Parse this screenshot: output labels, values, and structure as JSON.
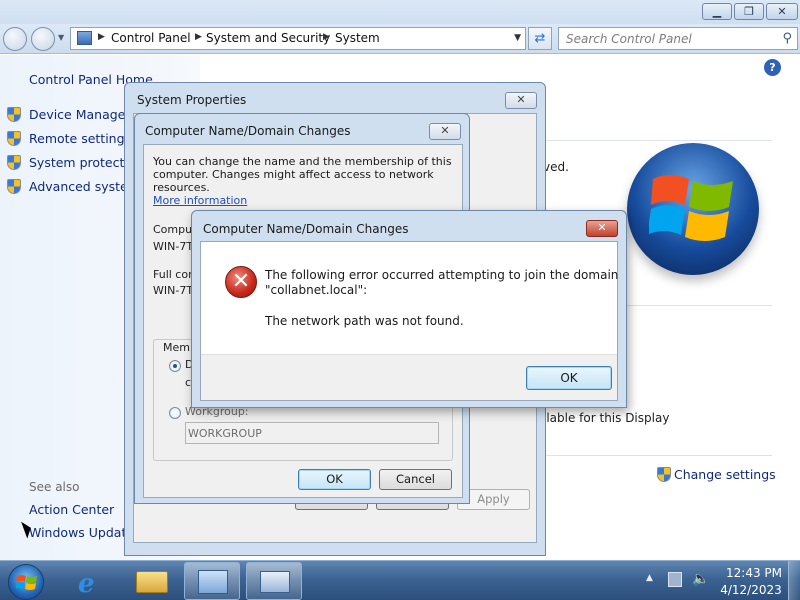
{
  "explorer": {
    "title_controls": {
      "minimize": "▁",
      "maximize": "❐",
      "close": "✕"
    },
    "breadcrumb": [
      "Control Panel",
      "System and Security",
      "System"
    ],
    "search_placeholder": "Search Control Panel",
    "sidebar": {
      "home": "Control Panel Home",
      "links": [
        "Device Manager",
        "Remote settings",
        "System protection",
        "Advanced system"
      ],
      "see_also": "See also",
      "action_center": "Action Center",
      "windows_update": "Windows Update"
    },
    "partial_texts": [
      "omputer",
      "ved.",
      "ilable for this Display"
    ],
    "change_settings": "Change settings",
    "help": "?"
  },
  "system_properties": {
    "title": "System Properties",
    "ok": "OK",
    "cancel": "Cancel",
    "apply": "Apply"
  },
  "name_changes": {
    "title": "Computer Name/Domain Changes",
    "description": "You can change the name and the membership of this computer. Changes might affect access to network resources.",
    "more_info": "More information",
    "computer_name_label": "Compute",
    "computer_name_value": "WIN-7T",
    "full_name_label": "Full com",
    "full_name_value": "WIN-7T",
    "member_of_label": "Memb",
    "domain_label": "D",
    "domain_line2": "c",
    "workgroup_label": "Workgroup:",
    "workgroup_value": "WORKGROUP",
    "ok": "OK",
    "cancel": "Cancel"
  },
  "error_dialog": {
    "title": "Computer Name/Domain Changes",
    "icon": "✕",
    "line1": "The following error occurred attempting to join the domain",
    "line2": "\"collabnet.local\":",
    "line3": "The network path was not found.",
    "ok": "OK"
  },
  "taskbar": {
    "time": "12:43 PM",
    "date": "4/12/2023",
    "ie_glyph": "e"
  },
  "colors": {
    "link": "#10297c",
    "taskbar": "#3c6392",
    "error_red": "#c8271b"
  }
}
